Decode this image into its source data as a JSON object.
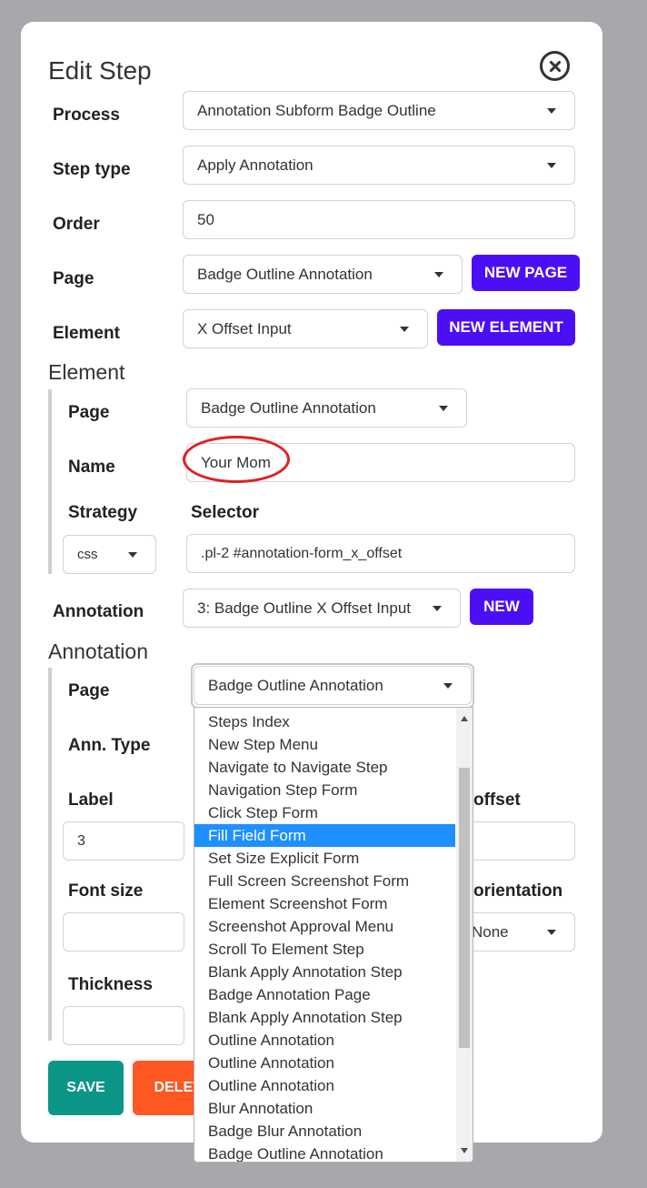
{
  "dialog": {
    "title": "Edit Step"
  },
  "form": {
    "process": {
      "label": "Process",
      "value": "Annotation Subform Badge Outline"
    },
    "step_type": {
      "label": "Step type",
      "value": "Apply Annotation"
    },
    "order": {
      "label": "Order",
      "value": "50"
    },
    "page": {
      "label": "Page",
      "value": "Badge Outline Annotation",
      "new_button": "NEW PAGE"
    },
    "element": {
      "label": "Element",
      "value": "X Offset Input",
      "new_button": "NEW ELEMENT"
    }
  },
  "element_section": {
    "heading": "Element",
    "page": {
      "label": "Page",
      "value": "Badge Outline Annotation"
    },
    "name": {
      "label": "Name",
      "value": "Your Mom"
    },
    "strategy": {
      "label": "Strategy",
      "value": "css"
    },
    "selector": {
      "label": "Selector",
      "value": ".pl-2 #annotation-form_x_offset"
    }
  },
  "annotation": {
    "label": "Annotation",
    "value": "3: Badge Outline X Offset Input",
    "new_button": "NEW"
  },
  "annotation_section": {
    "heading": "Annotation",
    "page": {
      "label": "Page",
      "value": "Badge Outline Annotation"
    },
    "ann_type": {
      "label": "Ann. Type"
    },
    "label_field": {
      "label": "Label",
      "value": "3"
    },
    "offset_label": "offset",
    "font_size": {
      "label": "Font size",
      "value": ""
    },
    "orientation": {
      "label": "orientation",
      "value": "None"
    },
    "thickness": {
      "label": "Thickness",
      "value": ""
    }
  },
  "actions": {
    "save": "SAVE",
    "delete": "DELETE"
  },
  "page_dropdown": {
    "options": [
      "Steps Index",
      "New Step Menu",
      "Navigate to Navigate Step",
      "Navigation Step Form",
      "Click Step Form",
      "Fill Field Form",
      "Set Size Explicit Form",
      "Full Screen Screenshot Form",
      "Element Screenshot Form",
      "Screenshot Approval Menu",
      "Scroll To Element Step",
      "Blank Apply Annotation Step",
      "Badge Annotation Page",
      "Blank Apply Annotation Step",
      "Outline Annotation",
      "Outline Annotation",
      "Outline Annotation",
      "Blur Annotation",
      "Badge Blur Annotation",
      "Badge Outline Annotation"
    ],
    "highlighted": "Fill Field Form"
  },
  "colors": {
    "primary_purple": "#4c0ff5",
    "save_green": "#0b9688",
    "delete_orange": "#ff5722",
    "highlight_blue": "#1e90ff",
    "annotation_red": "#e02020"
  }
}
